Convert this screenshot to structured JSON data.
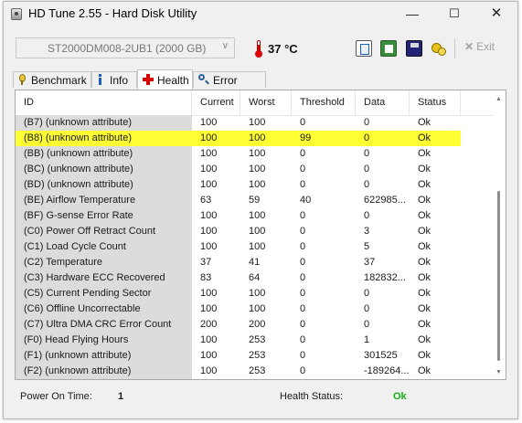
{
  "window": {
    "title": "HD Tune 2.55 - Hard Disk Utility"
  },
  "toolbar": {
    "drive": "ST2000DM008-2UB1 (2000 GB)",
    "temperature": "37 °C",
    "exit_label": "Exit"
  },
  "tabs": [
    {
      "label": "Benchmark"
    },
    {
      "label": "Info"
    },
    {
      "label": "Health"
    },
    {
      "label": "Error Scan"
    }
  ],
  "active_tab": "Health",
  "table": {
    "columns": [
      "ID",
      "Current",
      "Worst",
      "Threshold",
      "Data",
      "Status"
    ],
    "rows": [
      [
        "(B7) (unknown attribute)",
        "100",
        "100",
        "0",
        "0",
        "Ok"
      ],
      [
        "(B8) (unknown attribute)",
        "100",
        "100",
        "99",
        "0",
        "Ok"
      ],
      [
        "(BB) (unknown attribute)",
        "100",
        "100",
        "0",
        "0",
        "Ok"
      ],
      [
        "(BC) (unknown attribute)",
        "100",
        "100",
        "0",
        "0",
        "Ok"
      ],
      [
        "(BD) (unknown attribute)",
        "100",
        "100",
        "0",
        "0",
        "Ok"
      ],
      [
        "(BE) Airflow Temperature",
        "63",
        "59",
        "40",
        "622985...",
        "Ok"
      ],
      [
        "(BF) G-sense Error Rate",
        "100",
        "100",
        "0",
        "0",
        "Ok"
      ],
      [
        "(C0) Power Off Retract Count",
        "100",
        "100",
        "0",
        "3",
        "Ok"
      ],
      [
        "(C1) Load Cycle Count",
        "100",
        "100",
        "0",
        "5",
        "Ok"
      ],
      [
        "(C2) Temperature",
        "37",
        "41",
        "0",
        "37",
        "Ok"
      ],
      [
        "(C3) Hardware ECC Recovered",
        "83",
        "64",
        "0",
        "182832...",
        "Ok"
      ],
      [
        "(C5) Current Pending Sector",
        "100",
        "100",
        "0",
        "0",
        "Ok"
      ],
      [
        "(C6) Offline Uncorrectable",
        "100",
        "100",
        "0",
        "0",
        "Ok"
      ],
      [
        "(C7) Ultra DMA CRC Error Count",
        "200",
        "200",
        "0",
        "0",
        "Ok"
      ],
      [
        "(F0) Head Flying Hours",
        "100",
        "253",
        "0",
        "1",
        "Ok"
      ],
      [
        "(F1) (unknown attribute)",
        "100",
        "253",
        "0",
        "301525",
        "Ok"
      ],
      [
        "(F2) (unknown attribute)",
        "100",
        "253",
        "0",
        "-189264...",
        "Ok"
      ]
    ],
    "highlighted_row": 1,
    "highlight_color": "#ffff33"
  },
  "status": {
    "power_on_label": "Power On Time:",
    "power_on_value": "1",
    "health_label": "Health Status:",
    "health_value": "Ok",
    "health_color": "#12b012"
  }
}
